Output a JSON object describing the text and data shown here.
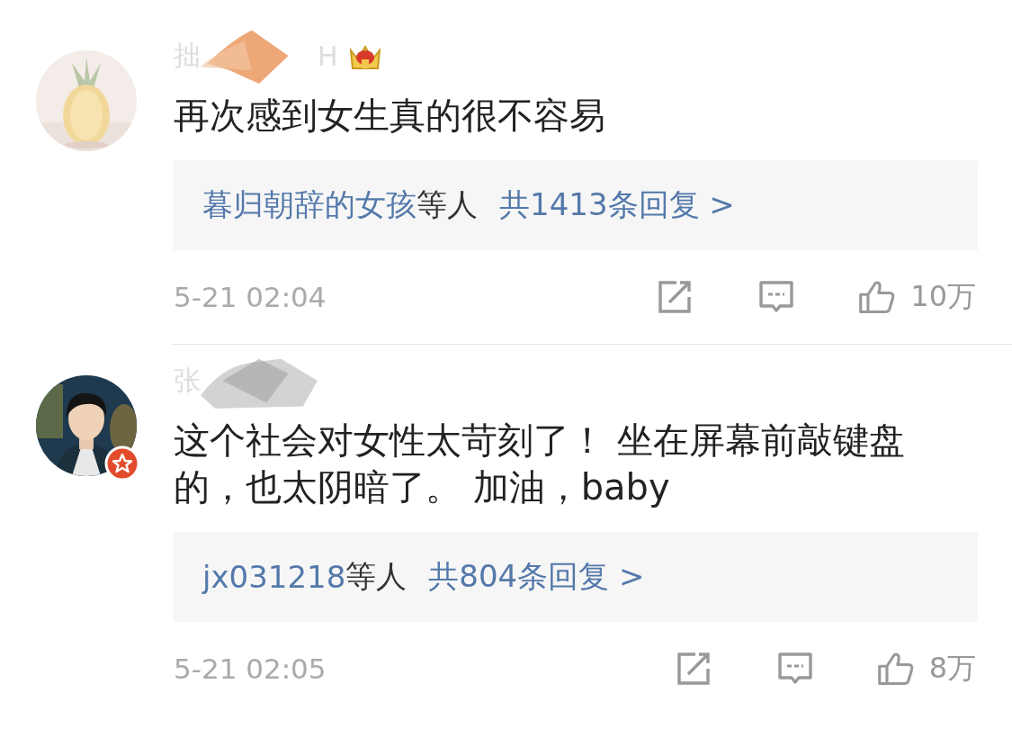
{
  "comments": [
    {
      "name_start": "拙",
      "name_end": "H",
      "badge": {
        "kind": "crown"
      },
      "text": "再次感到女生真的很不容易",
      "reply": {
        "users": "暮归朝辞的女孩",
        "suffix": "等人",
        "count": "共1413条回复 >"
      },
      "time": "5-21 02:04",
      "likes": "10万"
    },
    {
      "name_start": "张",
      "badge": {
        "kind": "star"
      },
      "text": "这个社会对女性太苛刻了！ 坐在屏幕前敲键盘的，也太阴暗了。 加油，baby",
      "reply": {
        "users": "jx031218",
        "suffix": "等人",
        "count": "共804条回复 >"
      },
      "time": "5-21 02:05",
      "likes": "8万"
    }
  ]
}
